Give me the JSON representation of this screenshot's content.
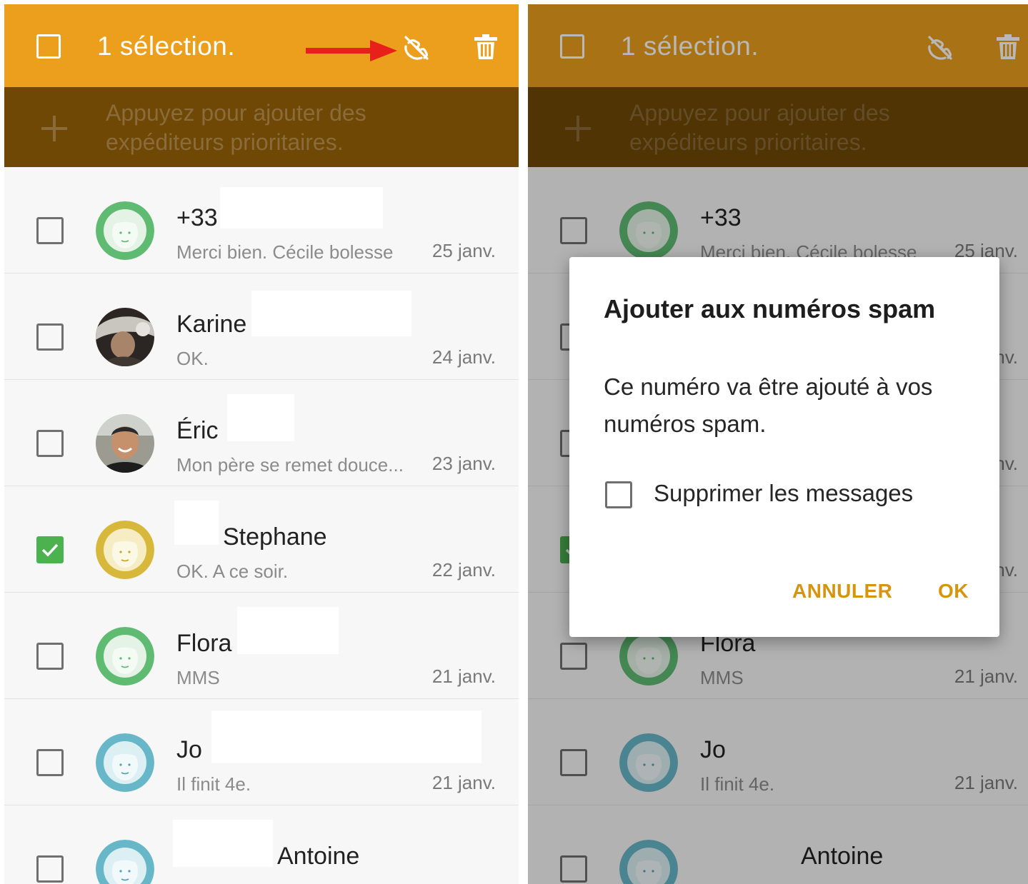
{
  "colors": {
    "accent": "#eb9f1c",
    "priority_bar": "#6f4806",
    "checkbox_checked": "#4cb14f",
    "dialog_button": "#d69411"
  },
  "left": {
    "topbar": {
      "title": "1 sélection."
    },
    "priority_hint": "Appuyez pour ajouter des expéditeurs prioritaires.",
    "conversations": [
      {
        "name": "+33",
        "preview": "Merci bien. Cécile bolesse",
        "date": "25 janv.",
        "checked": false,
        "avatar": "green-contact-icon"
      },
      {
        "name": "Karine",
        "preview": "OK.",
        "date": "24 janv.",
        "checked": false,
        "avatar": "photo-avatar"
      },
      {
        "name": "Éric",
        "preview": "Mon père se remet douce...",
        "date": "23 janv.",
        "checked": false,
        "avatar": "photo-avatar"
      },
      {
        "name": "Stephane",
        "preview": "OK.  A ce soir.",
        "date": "22 janv.",
        "checked": true,
        "avatar": "yellow-contact-icon"
      },
      {
        "name": "Flora",
        "preview": "MMS",
        "date": "21 janv.",
        "checked": false,
        "avatar": "green-contact-icon"
      },
      {
        "name": "Jo",
        "preview": "Il finit 4e.",
        "date": "21 janv.",
        "checked": false,
        "avatar": "blue-contact-icon"
      },
      {
        "name": "Antoine",
        "preview": "",
        "date": "",
        "checked": false,
        "avatar": "blue-contact-icon"
      }
    ]
  },
  "right": {
    "topbar": {
      "title": "1 sélection."
    },
    "priority_hint": "Appuyez pour ajouter des expéditeurs prioritaires.",
    "conversations": [
      {
        "name": "+33",
        "preview": "Merci bien. Cécile bolesse",
        "date": "25 janv."
      },
      {
        "name": "",
        "preview": "",
        "date": "24 janv."
      },
      {
        "name": "",
        "preview": "",
        "date": "23 janv."
      },
      {
        "name": "",
        "preview": "",
        "date": "22 janv."
      },
      {
        "name": "Flora",
        "preview": "MMS",
        "date": "21 janv."
      },
      {
        "name": "Jo",
        "preview": "Il finit 4e.",
        "date": "21 janv."
      },
      {
        "name": "Antoine",
        "preview": "",
        "date": ""
      }
    ],
    "dialog": {
      "title": "Ajouter aux numéros spam",
      "body": "Ce numéro va être ajouté à vos numéros spam.",
      "checkbox_label": "Supprimer les messages",
      "cancel_label": "ANNULER",
      "ok_label": "OK"
    }
  }
}
